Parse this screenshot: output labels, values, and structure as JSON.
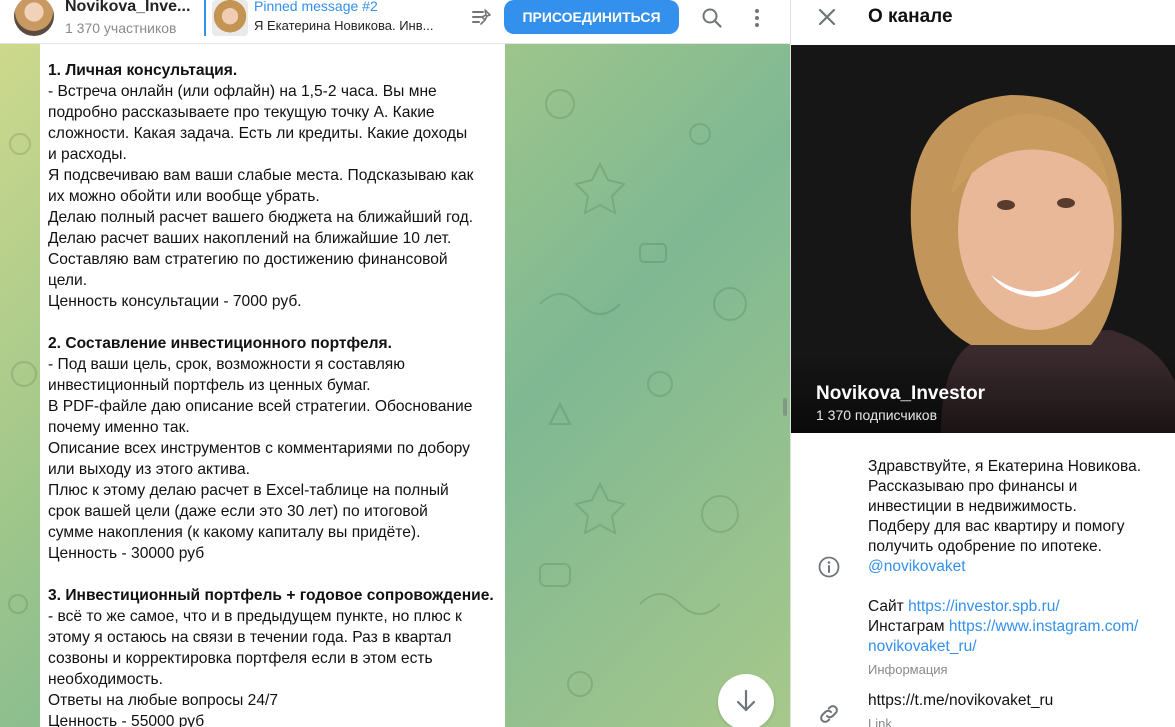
{
  "header": {
    "channel_title": "Novikova_Inve...",
    "channel_subtitle": "1 370 участников",
    "pinned_title": "Pinned message #2",
    "pinned_text": "Я Екатерина Новикова. Инв...",
    "join_label": "Присоединиться"
  },
  "message": {
    "lines": [
      "1. Личная консультация.",
      "- Встреча онлайн (или офлайн) на 1,5-2 часа. Вы мне",
      "подробно рассказываете про текущую точку А. Какие",
      "сложности. Какая задача. Есть ли кредиты. Какие доходы",
      "и расходы.",
      "Я подсвечиваю вам ваши слабые места. Подсказываю как",
      "их можно обойти или вообще убрать.",
      "Делаю полный расчет вашего бюджета на ближайший год.",
      "Делаю расчет ваших накоплений на ближайшие 10 лет.",
      "Составляю вам стратегию по достижению финансовой",
      "цели.",
      "Ценность консультации - 7000 руб.",
      "",
      "2. Составление инвестиционного портфеля.",
      "- Под ваши цель, срок, возможности я составляю",
      "инвестиционный портфель из ценных бумаг.",
      "В PDF-файле даю описание всей стратегии. Обоснование",
      "почему именно так.",
      "Описание всех инструментов с комментариями по добору",
      "или выходу из этого актива.",
      "Плюс к этому делаю расчет в Excel-таблице на полный",
      "срок вашей цели (даже если это 30 лет) по итоговой",
      "сумме накопления (к какому капиталу вы придёте).",
      "Ценность - 30000 руб",
      "",
      "3. Инвестиционный портфель + годовое сопровождение.",
      "- всё то же самое, что и в предыдущем пункте, но плюс к",
      "этому я остаюсь на связи в течении года. Раз в квартал",
      "созвоны и корректировка портфеля если в этом есть",
      "необходимость.",
      "Ответы на любые вопросы 24/7",
      "Ценность - 55000 руб"
    ]
  },
  "panel": {
    "title": "О канале",
    "name": "Novikova_Investor",
    "subscribers": "1 370 подписчиков",
    "description_lines": [
      "Здравствуйте, я Екатерина Новикова.",
      "Рассказываю про финансы и",
      "инвестиции в недвижимость.",
      "Подберу для вас квартиру и помогу",
      "получить одобрение по ипотеке."
    ],
    "handle": "@novikovaket",
    "site_label": "Сайт",
    "site_url": "https://investor.spb.ru/",
    "instagram_label": "Инстаграм",
    "instagram_url_1": "https://www.instagram.com/",
    "instagram_url_2": "novikovaket_ru/",
    "info_label": "Информация",
    "link_value": "https://t.me/novikovaket_ru",
    "link_label": "Link"
  },
  "colors": {
    "accent": "#3390ec",
    "chat_bg": "#9cc58b"
  },
  "icons": [
    "pinned-list-icon",
    "search-icon",
    "more-icon",
    "close-icon",
    "info-icon",
    "link-icon",
    "arrow-down-icon"
  ]
}
